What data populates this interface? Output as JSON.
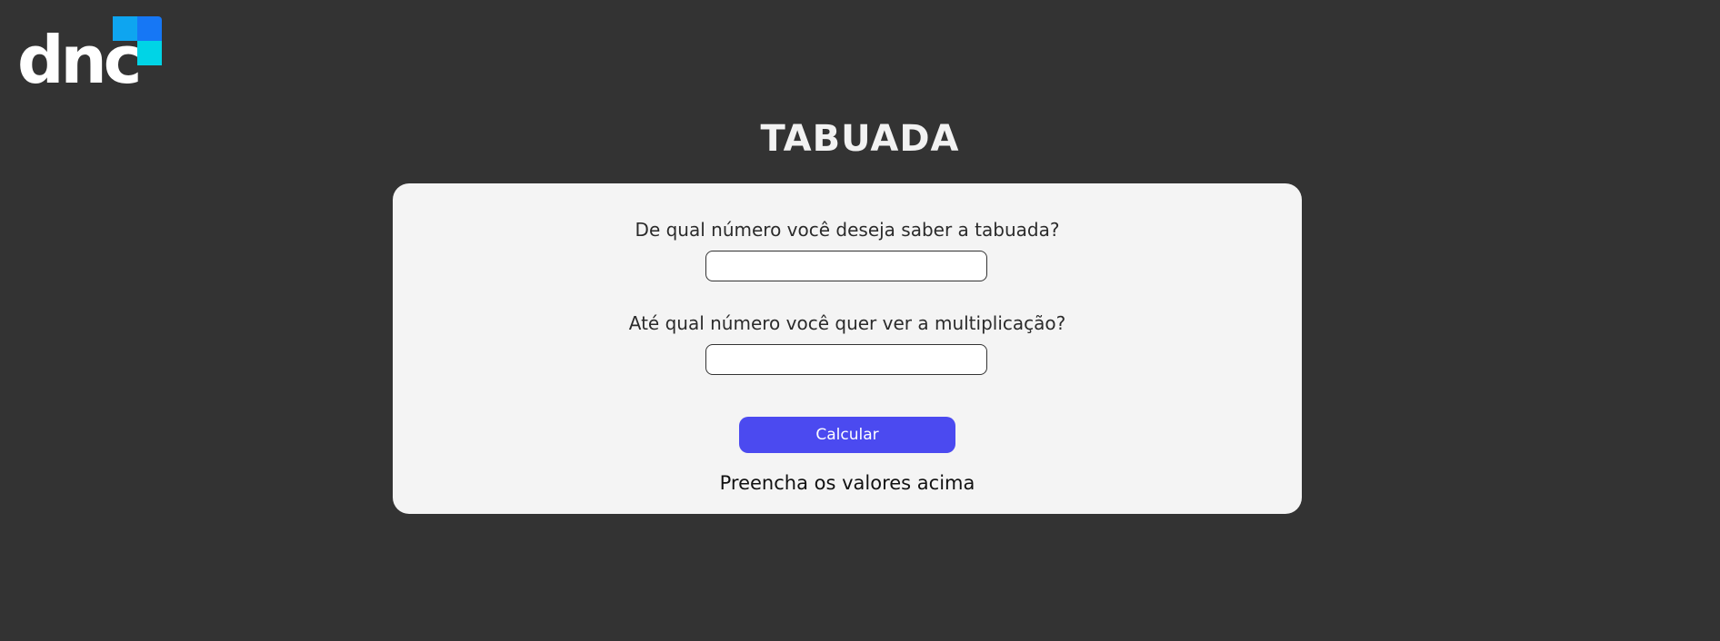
{
  "logo": {
    "text": "dnc",
    "colors": [
      "#0ea5f0",
      "#1677f5",
      "#00d4e6"
    ]
  },
  "page": {
    "title": "TABUADA"
  },
  "form": {
    "number_label": "De qual número você deseja saber a tabuada?",
    "number_value": "",
    "limit_label": "Até qual número você quer ver a multiplicação?",
    "limit_value": "",
    "calculate_label": "Calcular",
    "result_text": "Preencha os valores acima"
  },
  "colors": {
    "background": "#333333",
    "card": "#f4f4f4",
    "accent": "#4b4af0"
  }
}
